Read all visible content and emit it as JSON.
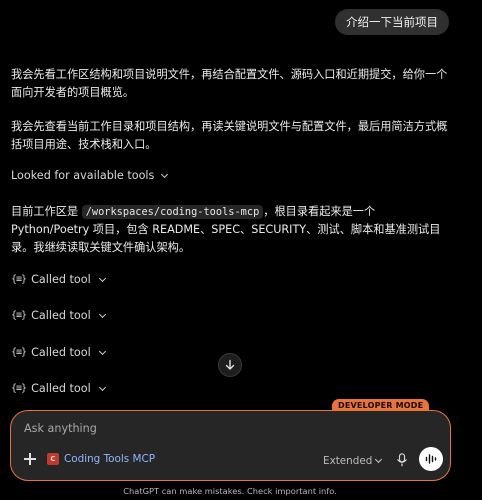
{
  "user_message": "介绍一下当前项目",
  "assistant": {
    "paragraph_1": "我会先看工作区结构和项目说明文件，再结合配置文件、源码入口和近期提交，给你一个面向开发者的项目概览。",
    "paragraph_2": "我会先查看当前工作目录和项目结构，再读关键说明文件与配置文件，最后用简洁方式概括项目用途、技术栈和入口。",
    "looked_label": "Looked for available tools",
    "paragraph_3_prefix": "目前工作区是 ",
    "paragraph_3_code": "/workspaces/coding-tools-mcp",
    "paragraph_3_suffix": "，根目录看起来是一个 Python/Poetry 项目，包含 README、SPEC、SECURITY、测试、脚本和基准测试目录。我继续读取关键文件确认架构。",
    "tool_calls": [
      {
        "label": "Called tool"
      },
      {
        "label": "Called tool"
      },
      {
        "label": "Called tool"
      },
      {
        "label": "Called tool"
      }
    ]
  },
  "composer": {
    "badge": "DEVELOPER MODE",
    "placeholder": "Ask anything",
    "tool_chip_label": "Coding Tools MCP",
    "tool_chip_icon_letter": "C",
    "model_label": "Extended",
    "accent_color": "#e8743c"
  },
  "icons": {
    "tool": "tool-call-icon",
    "scroll": "arrow-down-icon",
    "add": "plus-icon",
    "mic": "mic-icon",
    "voice": "voice-waveform-icon"
  },
  "footer": {
    "disclaimer": "ChatGPT can make mistakes. Check important info."
  }
}
